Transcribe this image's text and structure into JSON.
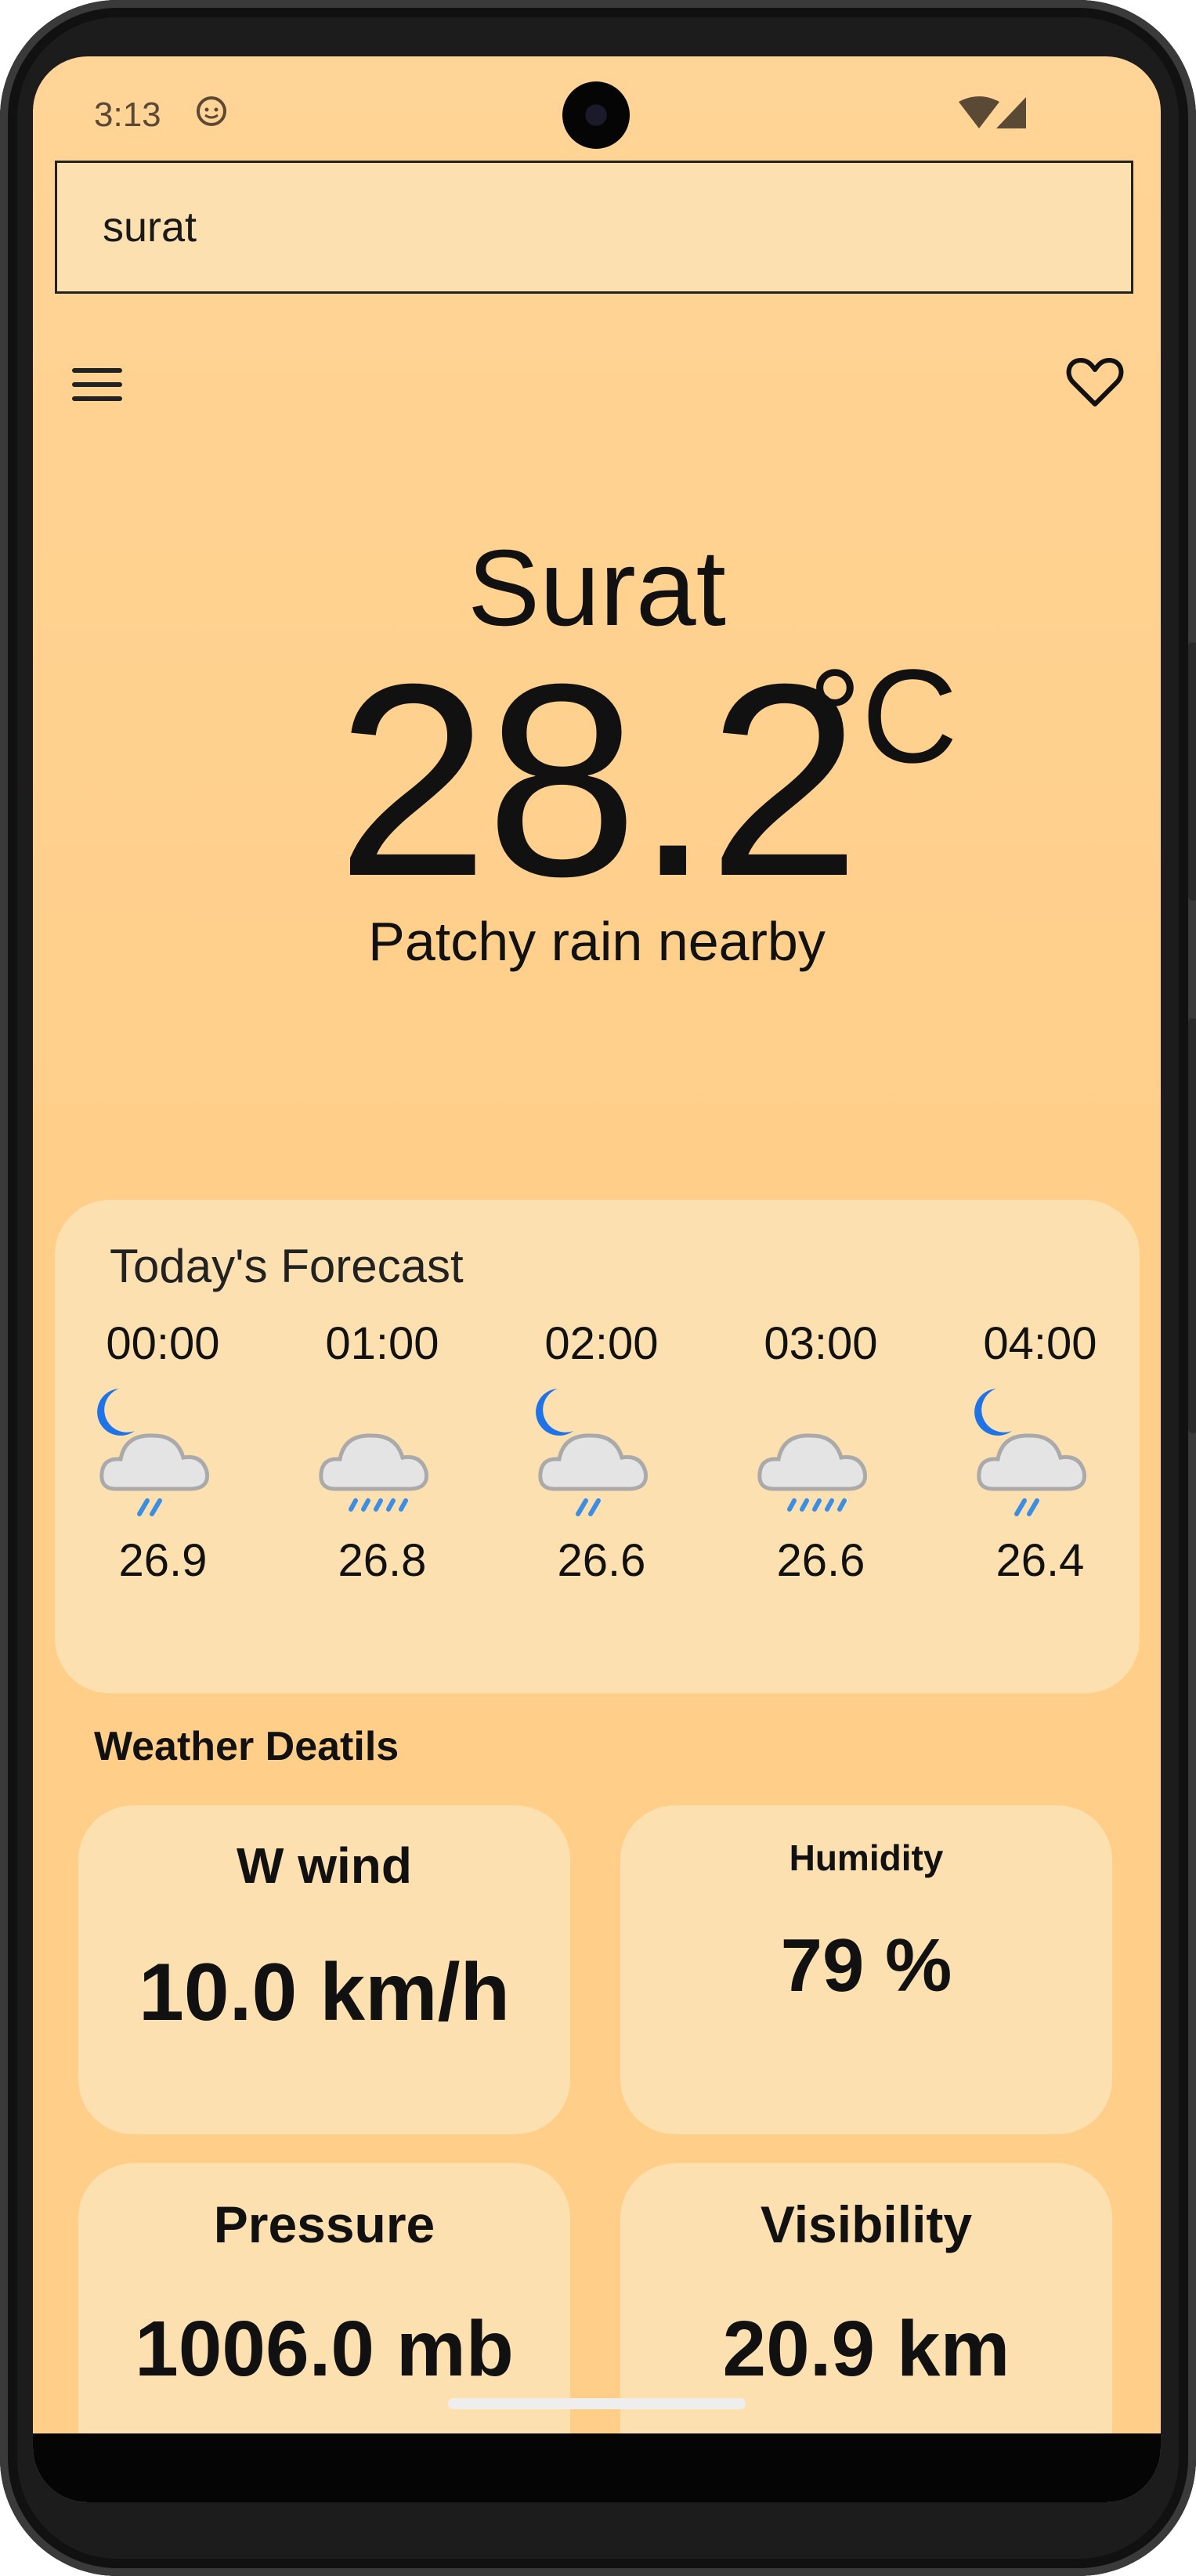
{
  "status": {
    "time": "3:13"
  },
  "search": {
    "value": "surat"
  },
  "current": {
    "city": "Surat",
    "temperature": "28.2",
    "unit": "°C",
    "condition": "Patchy rain nearby"
  },
  "forecast": {
    "title": "Today's Forecast",
    "hours": [
      {
        "time": "00:00",
        "temp": "26.9",
        "icon": "night-rain-icon"
      },
      {
        "time": "01:00",
        "temp": "26.8",
        "icon": "cloud-rain-icon"
      },
      {
        "time": "02:00",
        "temp": "26.6",
        "icon": "night-rain-icon"
      },
      {
        "time": "03:00",
        "temp": "26.6",
        "icon": "cloud-rain-icon"
      },
      {
        "time": "04:00",
        "temp": "26.4",
        "icon": "night-rain-icon"
      }
    ]
  },
  "details": {
    "title": "Weather Deatils",
    "wind": {
      "label": "W wind",
      "value": "10.0 km/h"
    },
    "humidity": {
      "label": "Humidity",
      "value": "79 %"
    },
    "pressure": {
      "label": "Pressure",
      "value": "1006.0 mb"
    },
    "visibility": {
      "label": "Visibility",
      "value": "20.9 km"
    }
  },
  "colors": {
    "background": "#ffcf8a",
    "card": "#fde0b0",
    "moon": "#1e73e8",
    "rain": "#3a8ee6"
  }
}
